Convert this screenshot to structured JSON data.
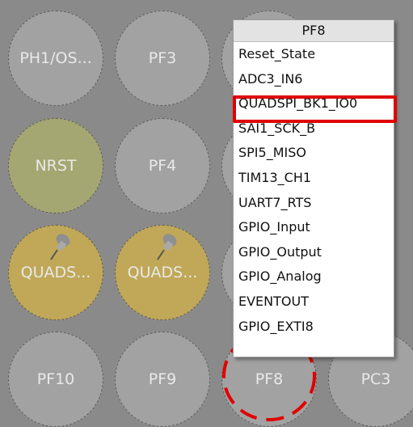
{
  "pins": {
    "ph1": "PH1/OS...",
    "pf3": "PF3",
    "nrst": "NRST",
    "pf4": "PF4",
    "quads_1": "QUADS...",
    "quads_2": "QUADS...",
    "pf10": "PF10",
    "pf9": "PF9",
    "pf8": "PF8",
    "pc3": "PC3"
  },
  "menu": {
    "title": "PF8",
    "items": [
      "Reset_State",
      "ADC3_IN6",
      "QUADSPI_BK1_IO0",
      "SAI1_SCK_B",
      "SPI5_MISO",
      "TIM13_CH1",
      "UART7_RTS",
      "GPIO_Input",
      "GPIO_Output",
      "GPIO_Analog",
      "EVENTOUT",
      "GPIO_EXTI8"
    ],
    "highlighted_item": "QUADSPI_BK1_IO0"
  },
  "colors": {
    "pin_default": "#a2a2a2",
    "pin_reset": "#a5a772",
    "pin_assigned": "#c0a858",
    "highlight": "#e00000"
  }
}
